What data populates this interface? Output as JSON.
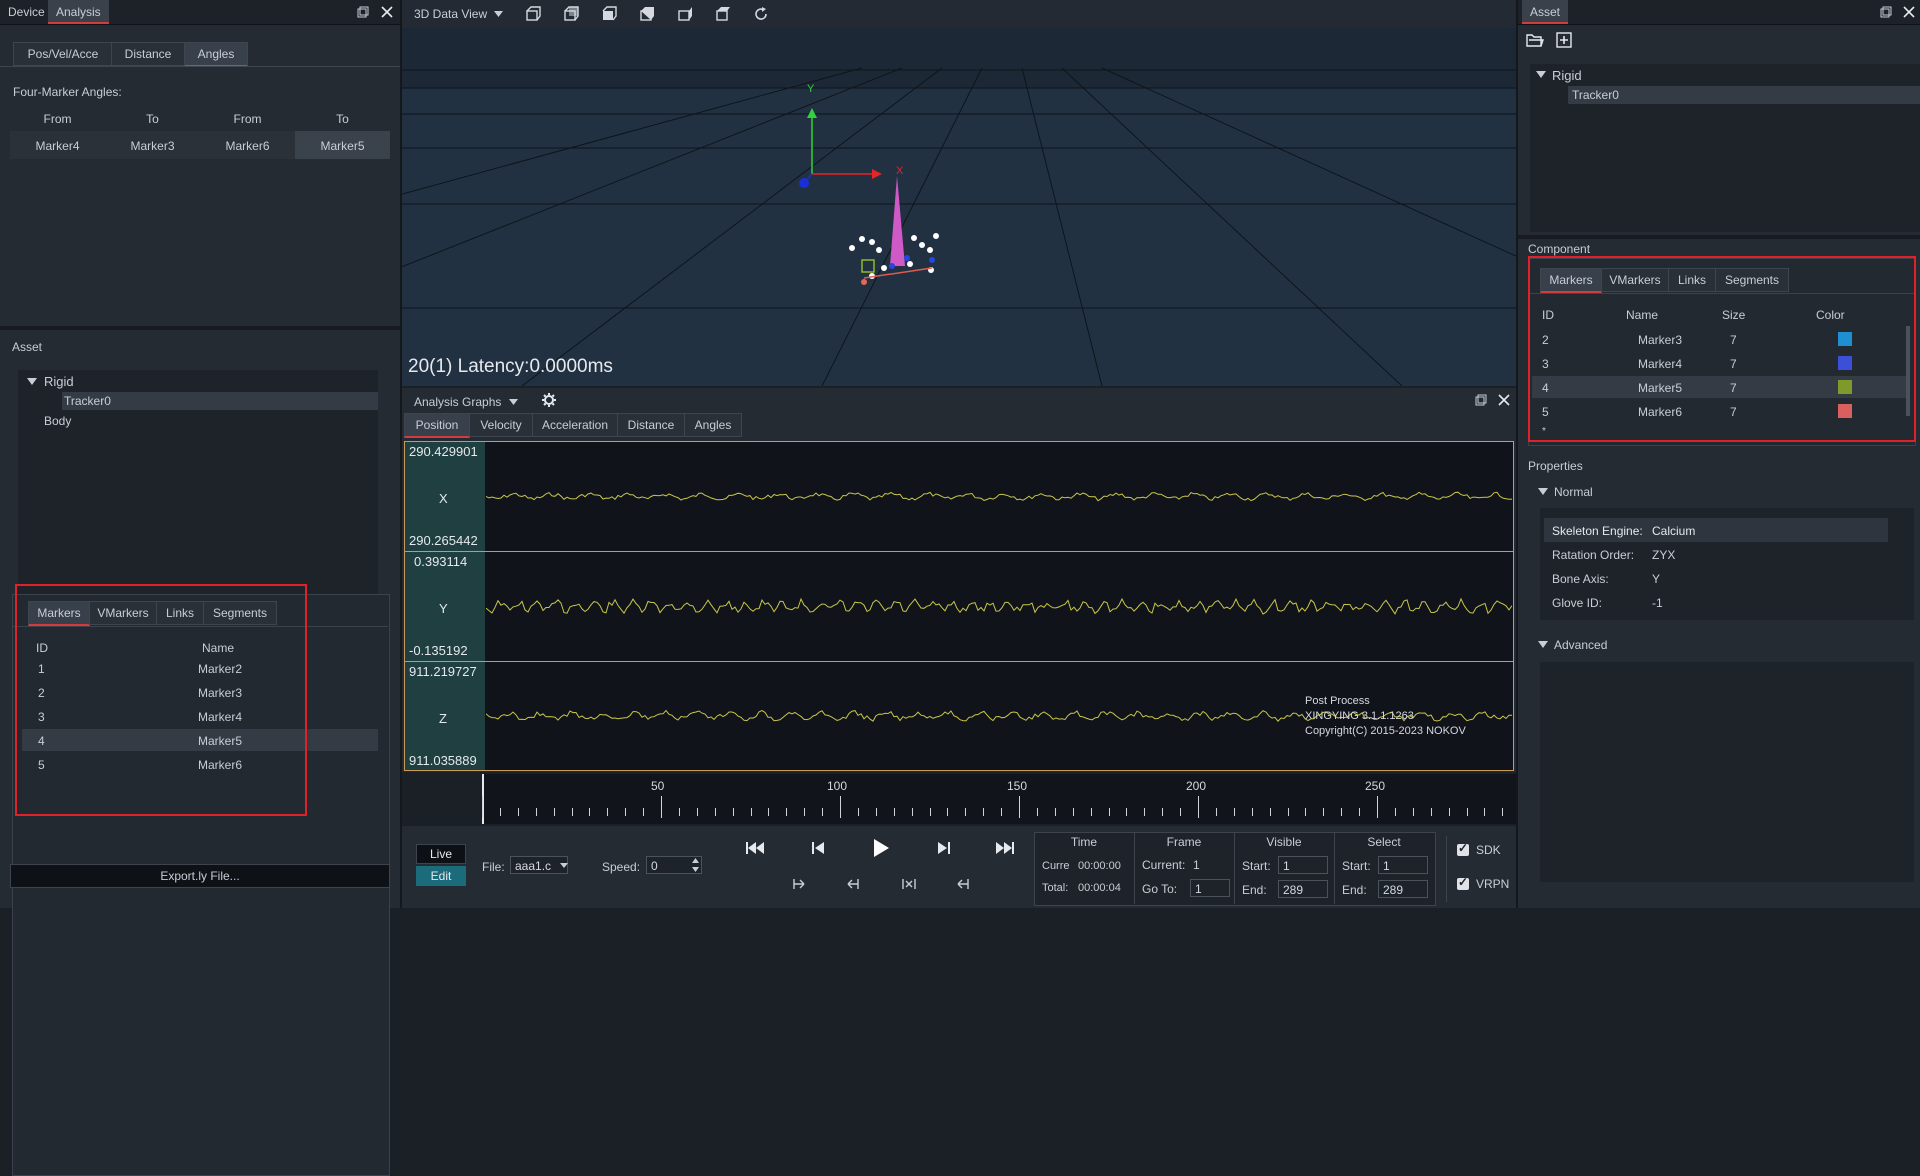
{
  "left_panel": {
    "tabs": [
      "Device",
      "Analysis"
    ],
    "subtabs": [
      "Pos/Vel/Acce",
      "Distance",
      "Angles"
    ],
    "section_label": "Four-Marker Angles:",
    "angle_headers": [
      "From",
      "To",
      "From",
      "To"
    ],
    "angle_values": [
      "Marker4",
      "Marker3",
      "Marker6",
      "Marker5"
    ],
    "asset_label": "Asset",
    "tree": {
      "root": "Rigid",
      "child": "Tracker0",
      "body": "Body"
    },
    "component_tabs": [
      "Markers",
      "VMarkers",
      "Links",
      "Segments"
    ],
    "table_headers": [
      "ID",
      "Name"
    ],
    "rows": [
      {
        "id": "1",
        "name": "Marker2"
      },
      {
        "id": "2",
        "name": "Marker3"
      },
      {
        "id": "3",
        "name": "Marker4"
      },
      {
        "id": "4",
        "name": "Marker5"
      },
      {
        "id": "5",
        "name": "Marker6"
      }
    ],
    "export_button": "Export.ly File..."
  },
  "view3d": {
    "title": "3D Data View",
    "status": "20(1) Latency:0.0000ms",
    "axis_x": "X",
    "axis_y": "Y"
  },
  "graphs": {
    "title": "Analysis Graphs",
    "tabs": [
      "Position",
      "Velocity",
      "Acceleration",
      "Distance",
      "Angles"
    ],
    "channels": [
      {
        "axis": "X",
        "max": "290.429901",
        "min": "290.265442"
      },
      {
        "axis": "Y",
        "max": "0.393114",
        "min": "-0.135192"
      },
      {
        "axis": "Z",
        "max": "911.219727",
        "min": "911.035889"
      }
    ],
    "watermark": [
      "Post Process",
      "XINGYING 3.1.1.1263",
      "Copyright(C) 2015-2023 NOKOV"
    ]
  },
  "timeline": {
    "labels": [
      "50",
      "100",
      "150",
      "200",
      "250"
    ],
    "live": "Live",
    "edit": "Edit",
    "file_label": "File:",
    "file_value": "aaa1.c",
    "speed_label": "Speed:",
    "speed_value": "0",
    "time_header": "Time",
    "time_current_label": "Curre",
    "time_current": "00:00:00",
    "time_total_label": "Total:",
    "time_total": "00:00:04",
    "frame_header": "Frame",
    "frame_current_label": "Current:",
    "frame_current": "1",
    "frame_goto_label": "Go To:",
    "frame_goto": "1",
    "visible_header": "Visible",
    "select_header": "Select",
    "start_label": "Start:",
    "end_label": "End:",
    "visible_start": "1",
    "visible_end": "289",
    "select_start": "1",
    "select_end": "289",
    "sdk": "SDK",
    "vrpn": "VRPN"
  },
  "right_panel": {
    "tab": "Asset",
    "tree": {
      "root": "Rigid",
      "child": "Tracker0"
    },
    "component_label": "Component",
    "component_tabs": [
      "Markers",
      "VMarkers",
      "Links",
      "Segments"
    ],
    "table_headers": [
      "ID",
      "Name",
      "Size",
      "Color"
    ],
    "rows": [
      {
        "id": "2",
        "name": "Marker3",
        "size": "7",
        "color": "#1e8fd0"
      },
      {
        "id": "3",
        "name": "Marker4",
        "size": "7",
        "color": "#3b4fd8"
      },
      {
        "id": "4",
        "name": "Marker5",
        "size": "7",
        "color": "#7d9a2a"
      },
      {
        "id": "5",
        "name": "Marker6",
        "size": "7",
        "color": "#d9605f"
      }
    ],
    "new_row": "*",
    "properties_label": "Properties",
    "normal_label": "Normal",
    "props": [
      {
        "key": "Skeleton Engine:",
        "value": "Calcium"
      },
      {
        "key": "Ratation Order:",
        "value": "ZYX"
      },
      {
        "key": "Bone Axis:",
        "value": "Y"
      },
      {
        "key": "Glove ID:",
        "value": "-1"
      }
    ],
    "advanced_label": "Advanced"
  }
}
